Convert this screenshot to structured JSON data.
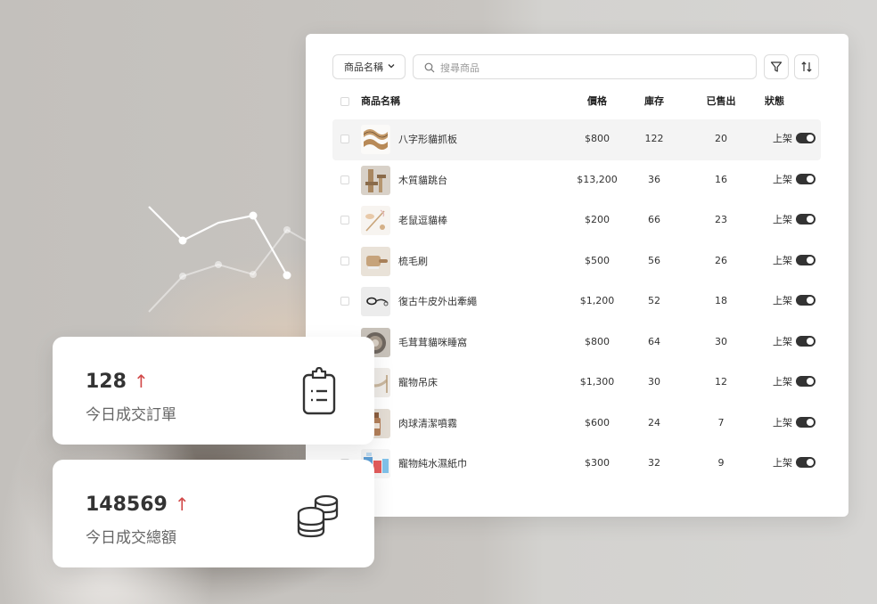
{
  "toolbar": {
    "dropdown_label": "商品名稱",
    "search_placeholder": "搜尋商品"
  },
  "table": {
    "headers": {
      "name": "商品名稱",
      "price": "價格",
      "stock": "庫存",
      "sold": "已售出",
      "status": "狀態"
    },
    "rows": [
      {
        "name": "八字形貓抓板",
        "price": "$800",
        "stock": "122",
        "sold": "20",
        "status": "上架",
        "thumb": "scratcher"
      },
      {
        "name": "木質貓跳台",
        "price": "$13,200",
        "stock": "36",
        "sold": "16",
        "status": "上架",
        "thumb": "cat-tree"
      },
      {
        "name": "老鼠逗貓棒",
        "price": "$200",
        "stock": "66",
        "sold": "23",
        "status": "上架",
        "thumb": "teaser"
      },
      {
        "name": "梳毛刷",
        "price": "$500",
        "stock": "56",
        "sold": "26",
        "status": "上架",
        "thumb": "brush"
      },
      {
        "name": "復古牛皮外出牽繩",
        "price": "$1,200",
        "stock": "52",
        "sold": "18",
        "status": "上架",
        "thumb": "leash"
      },
      {
        "name": "毛茸茸貓咪睡窩",
        "price": "$800",
        "stock": "64",
        "sold": "30",
        "status": "上架",
        "thumb": "bed"
      },
      {
        "name": "寵物吊床",
        "price": "$1,300",
        "stock": "30",
        "sold": "12",
        "status": "上架",
        "thumb": "hammock"
      },
      {
        "name": "肉球清潔噴霧",
        "price": "$600",
        "stock": "24",
        "sold": "7",
        "status": "上架",
        "thumb": "spray"
      },
      {
        "name": "寵物純水濕紙巾",
        "price": "$300",
        "stock": "32",
        "sold": "9",
        "status": "上架",
        "thumb": "wipes"
      }
    ]
  },
  "cards": [
    {
      "value": "128",
      "trend": "↑",
      "label": "今日成交訂單",
      "icon": "clipboard-icon"
    },
    {
      "value": "148569",
      "trend": "↑",
      "label": "今日成交總額",
      "icon": "coins-icon"
    }
  ],
  "colors": {
    "trend_up": "#d24a4a",
    "toggle_on": "#333333",
    "panel_bg": "#ffffff"
  }
}
